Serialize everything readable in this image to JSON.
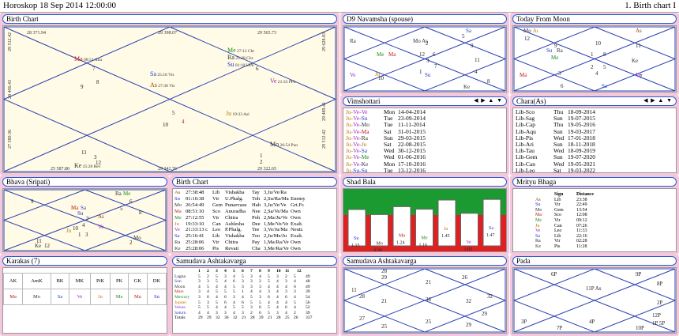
{
  "title": {
    "left": "Horoskop   18 Sep 2014 12:00:00",
    "right": "1. Birth chart I"
  },
  "colors": {
    "Su": "#2233cc",
    "Mo": "#333333",
    "Ma": "#c01818",
    "Me": "#1a8a1a",
    "Ju": "#c07800",
    "Ve": "#a020c0",
    "Sa": "#2244cc",
    "Ra": "#333333",
    "Ke": "#333333",
    "As": "#8b3a00"
  },
  "panels": {
    "birth_chart": "Birth Chart",
    "d9": "D9 Navamsha  (spouse)",
    "today": "Today From Moon",
    "vimshottari": "Vimshottari",
    "chara": "Chara(As)",
    "bhava": "Bhava (Sripati)",
    "birth_table": "Birth Chart",
    "shad_bala": "Shad Bala",
    "mrityu": "Mrityu Bhaga",
    "karakas": "Karakas (7)",
    "sav1": "Samudava Ashtakavarga",
    "sav2": "Samudava Ashtakavarga",
    "pada": "Pada"
  },
  "birth_chart": {
    "degrees": [
      "28  371.94",
      "29  398.07",
      "29  565.73",
      "29  512.42",
      "28  406.43",
      "29  628.83",
      "27  580.36",
      "29  489.41",
      "25  587.80",
      "29  342.76",
      "29  322.65",
      "29  512.42"
    ],
    "signs": [
      "7",
      "8",
      "9",
      "6",
      "10",
      "4",
      "5",
      "1",
      "3",
      "11",
      "12",
      "2"
    ],
    "planets": [
      {
        "t": "Ma 08:51 Anu",
        "c": "Ma"
      },
      {
        "t": "Sa 25:16 Vis",
        "c": "Sa"
      },
      {
        "t": "As 27:38 Vis",
        "c": "As"
      },
      {
        "t": "Me 27:12 Cht",
        "c": "Me"
      },
      {
        "t": "Ra 25:28 Cht",
        "c": "Ra"
      },
      {
        "t": "Su 01:10 UPh",
        "c": "Su"
      },
      {
        "t": "Ve 21:33 PPh",
        "c": "Ve"
      },
      {
        "t": "Ju 19:33 Asl",
        "c": "Ju"
      },
      {
        "t": "Mo 26:54 Pun",
        "c": "Mo"
      },
      {
        "t": "Ke 25:28 Rev",
        "c": "Ke"
      }
    ]
  },
  "d9": {
    "nums": [
      "5",
      "2",
      "12",
      "1",
      "6",
      "3",
      "7",
      "9",
      "4",
      "8",
      "10",
      "11"
    ],
    "planets": [
      "Sa",
      "Ra",
      "Mo As",
      "Me",
      "Ma",
      "Ve",
      "Ju",
      "Su",
      "Ke"
    ]
  },
  "today": {
    "nums": [
      "12",
      "9",
      "11",
      "10",
      "1",
      "8",
      "2",
      "5",
      "3",
      "7",
      "4",
      "6"
    ],
    "planets": [
      "Mo",
      "Ju",
      "As",
      "Su",
      "Ra",
      "Me",
      "Ke",
      "Ma",
      "Sa",
      "Ve"
    ]
  },
  "vimshottari": [
    [
      "Ju-Ve-Ve",
      "Mon",
      "14-04-2014"
    ],
    [
      "Ju-Ve-Su",
      "Tue",
      "23-09-2014"
    ],
    [
      "Ju-Ve-Mo",
      "Tue",
      "11-11-2014"
    ],
    [
      "Ju-Ve-Ma",
      "Sat",
      "31-01-2015"
    ],
    [
      "Ju-Ve-Ra",
      "Sun",
      "29-03-2015"
    ],
    [
      "Ju-Ve-Ju",
      "Sat",
      "22-08-2015"
    ],
    [
      "Ju-Ve-Sa",
      "Wed",
      "30-12-2015"
    ],
    [
      "Ju-Ve-Me",
      "Wed",
      "01-06-2016"
    ],
    [
      "Ju-Ve-Ke",
      "Mon",
      "17-10-2016"
    ],
    [
      "Ju-Su-Su",
      "Tue",
      "13-12-2016"
    ]
  ],
  "chara": [
    [
      "Lib-Sco",
      "Thu",
      "18-09-2014"
    ],
    [
      "Lib-Sag",
      "Sun",
      "19-07-2015"
    ],
    [
      "Lib-Cap",
      "Thu",
      "19-05-2016"
    ],
    [
      "Lib-Aqu",
      "Sun",
      "19-03-2017"
    ],
    [
      "Lib-Pis",
      "Wed",
      "17-01-2018"
    ],
    [
      "Lib-Ari",
      "Sun",
      "18-11-2018"
    ],
    [
      "Lib-Tau",
      "Wed",
      "18-09-2019"
    ],
    [
      "Lib-Gem",
      "Sun",
      "19-07-2020"
    ],
    [
      "Lib-Can",
      "Wed",
      "19-05-2021"
    ],
    [
      "Lib-Leo",
      "Sat",
      "19-03-2022"
    ]
  ],
  "bhava": {
    "nums": [
      "9",
      "6",
      "5",
      "7",
      "4",
      "10",
      "1",
      "3",
      "11",
      "12",
      "2",
      "8"
    ],
    "planets": [
      "Ra",
      "Me",
      "Ma",
      "Sa",
      "Su",
      "As",
      "Ju",
      "Ve",
      "Mo",
      "Ke"
    ]
  },
  "birth_table": [
    [
      "As",
      "27:38:48",
      "Lib",
      "Vishakha",
      "Tay",
      "3,Ju/Ve/Ra",
      ""
    ],
    [
      "Su",
      "01:10:38",
      "Vir",
      "U.Phalg.",
      "Toh",
      "2,Su/Ra/Ma",
      "Enemy"
    ],
    [
      "Mo",
      "26:54:49",
      "Gem",
      "Punarvasu",
      "Hah",
      "3,Ju/Ve/Ve",
      "Grt.Fr."
    ],
    [
      "Ma",
      "08:51:10",
      "Sco",
      "Anuradha",
      "Nee",
      "2,Sa/Ve/Ma",
      "Own"
    ],
    [
      "Me",
      "27:12:55",
      "Vir",
      "Chitra",
      "Poh",
      "2,Ma/Ju/Ve",
      "Own"
    ],
    [
      "Ju",
      "19:33:10",
      "Can",
      "Ashlesha",
      "Dee",
      "1,Me/Ve/Ve",
      "Exalt."
    ],
    [
      "Ve",
      "21:33:13  c",
      "Leo",
      "P.Phalg.",
      "Tee",
      "3,Ve/Ju/Ma",
      "Neutr."
    ],
    [
      "Sa",
      "25:16:41",
      "Lib",
      "Vishakha",
      "Too",
      "2,Ju/Me/Ju",
      "Exalt."
    ],
    [
      "Ra",
      "25:28:06",
      "Vir",
      "Chitra",
      "Pay",
      "1,Ma/Ra/Ve",
      "Own"
    ],
    [
      "Ke",
      "25:28:06",
      "Pis",
      "Revati",
      "Cha",
      "3,Me/Ra/Ve",
      "Own"
    ]
  ],
  "shad_bala": [
    {
      "p": "Su",
      "v": "1.15",
      "n": 1.15
    },
    {
      "p": "Mo",
      "v": "0.99",
      "n": 0.99
    },
    {
      "p": "Ma",
      "v": "1.24",
      "n": 1.24
    },
    {
      "p": "Me",
      "v": "1.16",
      "n": 1.16
    },
    {
      "p": "Ju",
      "v": "1.45",
      "n": 1.45
    },
    {
      "p": "Ve",
      "v": "1.03",
      "n": 1.03
    },
    {
      "p": "Sa",
      "v": "1.47",
      "n": 1.47
    }
  ],
  "mrityu": {
    "head": [
      "Sign",
      "Distance"
    ],
    "rows": [
      [
        "As",
        "Lib",
        "23:38"
      ],
      [
        "Su",
        "Vir",
        "22:49"
      ],
      [
        "Mo",
        "Gem",
        "13:54"
      ],
      [
        "Ma",
        "Sco",
        "12:08"
      ],
      [
        "Me",
        "Vir",
        "09:12"
      ],
      [
        "Ju",
        "Can",
        "07:26"
      ],
      [
        "Ve",
        "Leo",
        "11:33"
      ],
      [
        "Sa",
        "Lib",
        "22:16"
      ],
      [
        "Ra",
        "Vir",
        "02:28"
      ],
      [
        "Ke",
        "Pis",
        "11:28"
      ]
    ]
  },
  "karakas": {
    "head": [
      "AK",
      "AmK",
      "BK",
      "MK",
      "PiK",
      "PK",
      "GK",
      "DK"
    ],
    "vals": [
      "Ma",
      "Mo",
      "Sa",
      "Ve",
      "Ju",
      "Me",
      "Ma",
      "Su"
    ]
  },
  "sav1": {
    "head": [
      "1",
      "2",
      "3",
      "4",
      "5",
      "6",
      "7",
      "8",
      "9",
      "10",
      "11",
      "12"
    ],
    "rows": [
      [
        "Lagna",
        "5",
        "2",
        "5",
        "3",
        "4",
        "5",
        "3",
        "4",
        "5",
        "3",
        "2",
        "5",
        "49"
      ],
      [
        "Sun",
        "3",
        "3",
        "5",
        "4",
        "6",
        "3",
        "3",
        "2",
        "5",
        "4",
        "3",
        "4",
        "48"
      ],
      [
        "Moon",
        "4",
        "5",
        "4",
        "4",
        "5",
        "3",
        "3",
        "3",
        "4",
        "4",
        "4",
        "6",
        "49"
      ],
      [
        "Mars",
        "3",
        "4",
        "5",
        "5",
        "5",
        "1",
        "4",
        "4",
        "3",
        "4",
        "3",
        "3",
        "39"
      ],
      [
        "Mercury",
        "3",
        "6",
        "4",
        "6",
        "3",
        "4",
        "5",
        "3",
        "6",
        "4",
        "6",
        "4",
        "54"
      ],
      [
        "Jupiter",
        "5",
        "3",
        "5",
        "6",
        "4",
        "6",
        "5",
        "5",
        "4",
        "4",
        "4",
        "5",
        "56"
      ],
      [
        "Venus",
        "5",
        "5",
        "4",
        "4",
        "5",
        "5",
        "3",
        "6",
        "5",
        "4",
        "6",
        "4",
        "52"
      ],
      [
        "Saturn",
        "4",
        "4",
        "3",
        "3",
        "4",
        "3",
        "2",
        "6",
        "5",
        "3",
        "4",
        "2",
        "39"
      ]
    ],
    "totals": [
      "Totals",
      "29",
      "29",
      "32",
      "36",
      "32",
      "21",
      "28",
      "29",
      "21",
      "28",
      "25",
      "26",
      "337"
    ]
  },
  "sav2": {
    "nums": [
      "28",
      "29",
      "26",
      "28",
      "21",
      "32",
      "36",
      "27",
      "25",
      "29",
      "32",
      "21",
      "11",
      "25",
      "29"
    ]
  },
  "pada": {
    "labels": [
      "6P",
      "9P",
      "11P As",
      "8P",
      "2P",
      "3P",
      "4P",
      "12P",
      "1P 5P",
      "7P",
      "10P"
    ]
  }
}
